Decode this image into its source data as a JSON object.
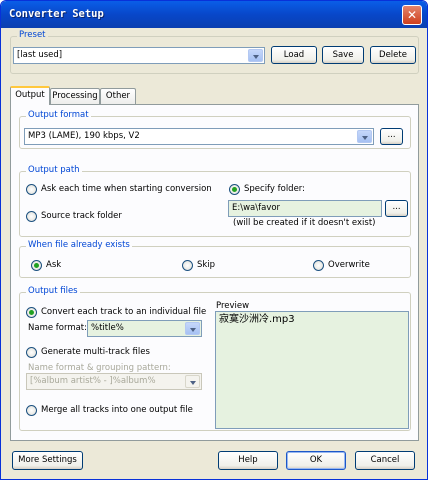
{
  "window": {
    "title": "Converter Setup",
    "close_glyph": "✕"
  },
  "preset": {
    "legend": "Preset",
    "value": "[last used]",
    "load_label": "Load",
    "save_label": "Save",
    "delete_label": "Delete"
  },
  "tabs": [
    {
      "label": "Output",
      "active": true
    },
    {
      "label": "Processing",
      "active": false
    },
    {
      "label": "Other",
      "active": false
    }
  ],
  "output_format": {
    "legend": "Output format",
    "value": "MP3 (LAME), 190 kbps, V2",
    "browse_label": "..."
  },
  "output_path": {
    "legend": "Output path",
    "ask_label": "Ask each time when starting conversion",
    "specify_label": "Specify folder:",
    "source_label": "Source track folder",
    "folder_value": "E:\\wa\\favor",
    "note": "(will be created if it doesn't exist)",
    "browse_label": "...",
    "selected": "specify"
  },
  "file_exists": {
    "legend": "When file already exists",
    "ask_label": "Ask",
    "skip_label": "Skip",
    "overwrite_label": "Overwrite",
    "selected": "ask"
  },
  "output_files": {
    "legend": "Output files",
    "convert_each_label": "Convert each track to an individual file",
    "name_format_label": "Name format:",
    "name_format_value": "%title%",
    "multitrack_label": "Generate multi-track files",
    "grouping_label": "Name format & grouping pattern:",
    "grouping_value": "[%album artist% - ]%album%",
    "merge_label": "Merge all tracks into one output file",
    "preview_label": "Preview",
    "preview_value": "寂寞沙洲冷.mp3",
    "selected": "convert_each"
  },
  "footer": {
    "more_settings_label": "More Settings",
    "help_label": "Help",
    "ok_label": "OK",
    "cancel_label": "Cancel"
  }
}
